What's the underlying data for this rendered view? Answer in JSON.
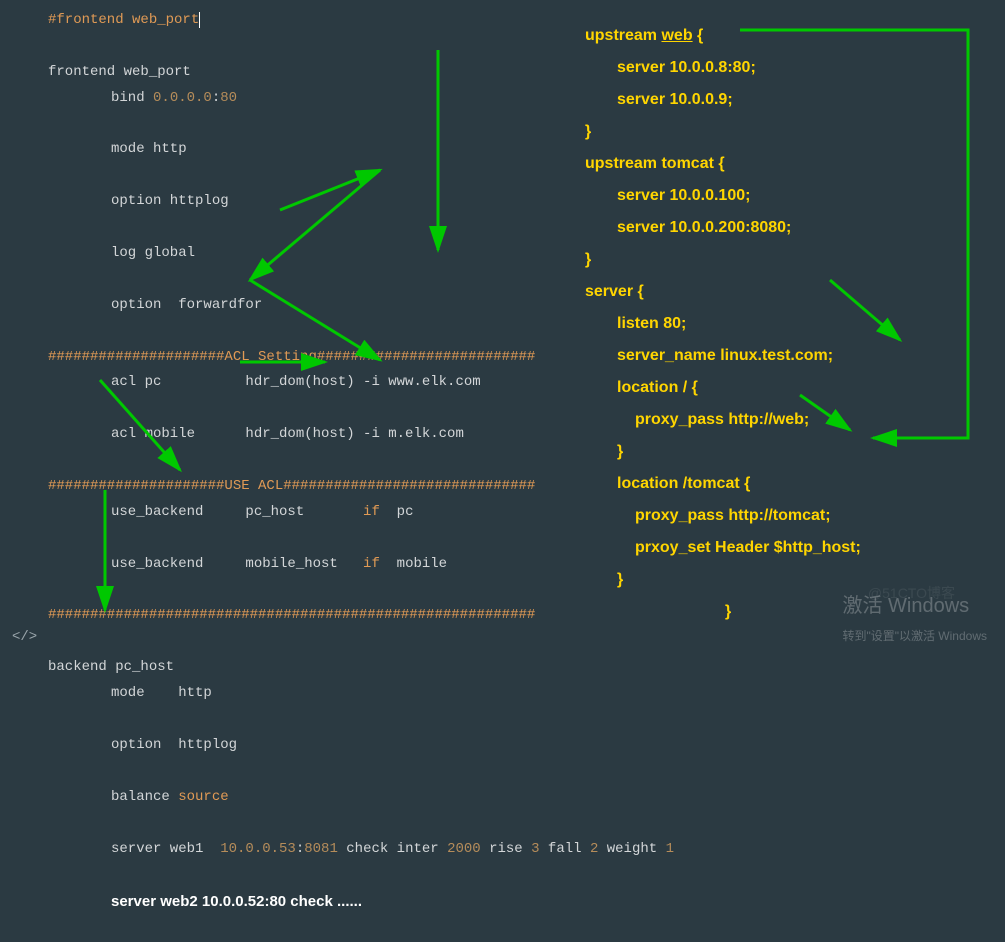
{
  "left": {
    "l1": "#frontend web_port",
    "l2": "frontend web_port",
    "l3_a": "bind ",
    "l3_b": "0.0.0.0",
    "l3_c": ":",
    "l3_d": "80",
    "l4": "mode http",
    "l5": "option httplog",
    "l6": "log global",
    "l7": "option  forwardfor",
    "l8": "#####################ACL Setting##########################",
    "l9": "acl pc          hdr_dom(host) -i www.elk.com",
    "l10": "acl mobile      hdr_dom(host) -i m.elk.com",
    "l11": "#####################USE ACL##############################",
    "l12_a": "use_backend     pc_host       ",
    "l12_if": "if",
    "l12_b": "  pc",
    "l13_a": "use_backend     mobile_host   ",
    "l13_if": "if",
    "l13_b": "  mobile",
    "l14": "##########################################################",
    "l15": "backend pc_host",
    "l16": "mode    http",
    "l17": "option  httplog",
    "l18_a": "balance ",
    "l18_b": "source",
    "l19_a": "server web1  ",
    "l19_b": "10.0.0.53",
    "l19_c": ":",
    "l19_d": "8081",
    "l19_e": " check inter ",
    "l19_f": "2000",
    "l19_g": " rise ",
    "l19_h": "3",
    "l19_i": " fall ",
    "l19_j": "2",
    "l19_k": " weight ",
    "l19_l": "1",
    "l20": "server web2 10.0.0.52:80 check ......"
  },
  "right": {
    "r1_a": "upstream ",
    "r1_b": "web",
    "r1_c": " {",
    "r2": "server 10.0.0.8:80;",
    "r3": "server 10.0.0.9;",
    "r4": "}",
    "r5": "upstream tomcat {",
    "r6": "server 10.0.0.100;",
    "r7": "server 10.0.0.200:8080;",
    "r8": "}",
    "r9": "server {",
    "r10": "listen 80;",
    "r11": "server_name linux.test.com;",
    "r12": "location / {",
    "r13": "proxy_pass http://web;",
    "r14": "}",
    "r15": "location /tomcat {",
    "r16": "proxy_pass http://tomcat;",
    "r17": "prxoy_set Header $http_host;",
    "r18": "}",
    "r19": "}"
  },
  "watermark": {
    "big": "激活 Windows",
    "small": "转到\"设置\"以激活 Windows"
  },
  "blog_wm": "@51CTO博客",
  "gutter": "</>"
}
